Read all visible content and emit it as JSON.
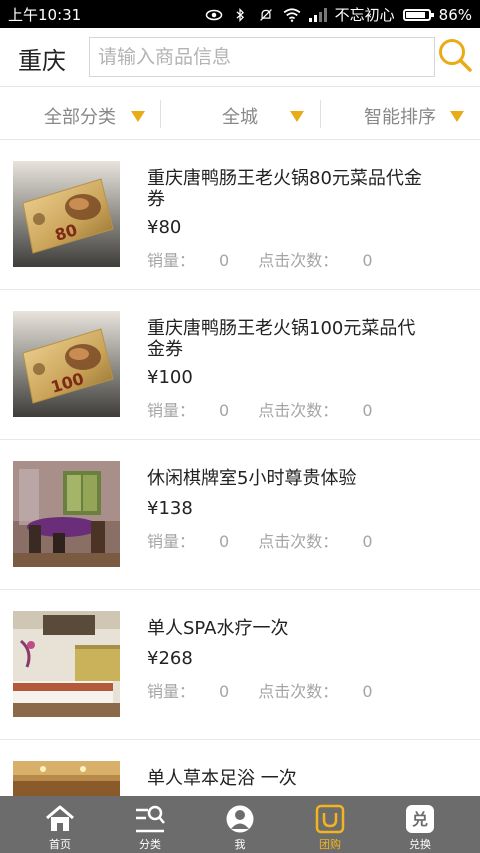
{
  "status_bar": {
    "time": "上午10:31",
    "carrier": "不忘初心",
    "battery": "86%",
    "battery_level": 0.86
  },
  "header": {
    "city": "重庆",
    "search_placeholder": "请输入商品信息",
    "accent_color": "#e9ac16"
  },
  "filters": [
    {
      "label": "全部分类"
    },
    {
      "label": "全城"
    },
    {
      "label": "智能排序"
    }
  ],
  "meta_labels": {
    "sales": "销量：",
    "clicks": "点击次数："
  },
  "items": [
    {
      "title": "重庆唐鸭肠王老火锅80元菜品代金券",
      "price": "¥80",
      "sales": "0",
      "clicks": "0",
      "image": "voucher-card"
    },
    {
      "title": "重庆唐鸭肠王老火锅100元菜品代金券",
      "price": "¥100",
      "sales": "0",
      "clicks": "0",
      "image": "voucher-card"
    },
    {
      "title": "休闲棋牌室5小时尊贵体验",
      "price": "¥138",
      "sales": "0",
      "clicks": "0",
      "image": "mahjong-room"
    },
    {
      "title": "单人SPA水疗一次",
      "price": "¥268",
      "sales": "0",
      "clicks": "0",
      "image": "spa-room"
    },
    {
      "title": "单人草本足浴 一次",
      "price": "",
      "sales": "",
      "clicks": "",
      "image": "footbath-room"
    }
  ],
  "voucher_amounts": [
    "80",
    "100"
  ],
  "bottom_nav": [
    {
      "label": "首页",
      "icon": "home-icon"
    },
    {
      "label": "分类",
      "icon": "category-search-icon"
    },
    {
      "label": "我",
      "icon": "user-icon"
    },
    {
      "label": "团购",
      "icon": "group-buy-icon",
      "active": true
    },
    {
      "label": "兑换",
      "icon": "exchange-icon"
    }
  ]
}
